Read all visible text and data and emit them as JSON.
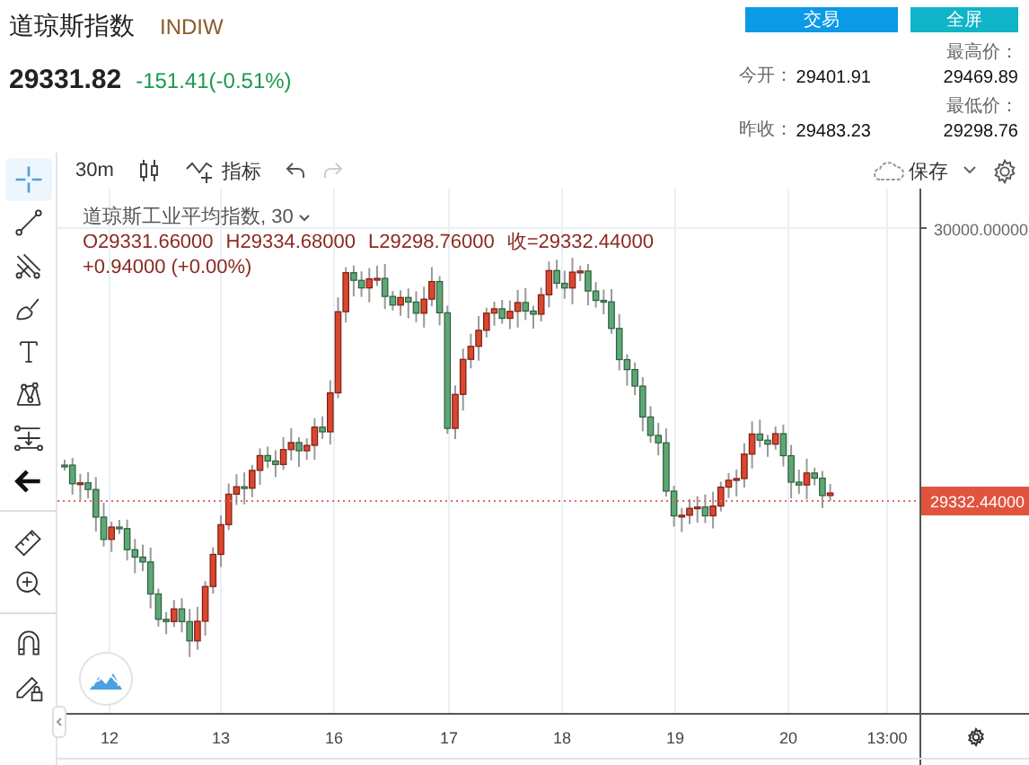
{
  "header": {
    "title": "道琼斯指数",
    "code": "INDIW",
    "price": "29331.82",
    "change": "-151.41(-0.51%)"
  },
  "buttons": [
    {
      "label": "交易",
      "kind": "trade"
    },
    {
      "label": "全屏",
      "kind": "fullscreen"
    }
  ],
  "stats": [
    {
      "label": "今开：",
      "value": "29401.91",
      "kind": "inline"
    },
    {
      "label": "最高价：",
      "value": "29469.89",
      "kind": "stacked"
    },
    {
      "label": "昨收：",
      "value": "29483.23",
      "kind": "inline"
    },
    {
      "label": "最低价：",
      "value": "29298.76",
      "kind": "stacked"
    }
  ],
  "toolbar": {
    "interval": "30m",
    "indicators": "指标",
    "save": "保存"
  },
  "side_tools": [
    {
      "kind": "crosshair",
      "selected": true
    },
    {
      "kind": "line",
      "selected": false
    },
    {
      "kind": "fork",
      "selected": false
    },
    {
      "kind": "brush",
      "selected": false
    },
    {
      "kind": "text",
      "selected": false
    },
    {
      "kind": "pattern",
      "selected": false
    },
    {
      "kind": "levels",
      "selected": false
    },
    {
      "kind": "back",
      "selected": false
    },
    {
      "kind": "ruler",
      "selected": false
    },
    {
      "kind": "zoom",
      "selected": false
    },
    {
      "kind": "magnet",
      "selected": false
    },
    {
      "kind": "lock",
      "selected": false
    }
  ],
  "chart": {
    "legend_title": "道琼斯工业平均指数, 30",
    "ohlc": [
      "O29331.66000",
      "H29334.68000",
      "L29298.76000",
      "收=29332.44000"
    ],
    "legend_change": "+0.94000 (+0.00%)",
    "y_tick": "30000.00000",
    "price_label": "29332.44000",
    "x_labels": [
      "12",
      "13",
      "16",
      "17",
      "18",
      "19",
      "20",
      "13:00"
    ]
  }
}
